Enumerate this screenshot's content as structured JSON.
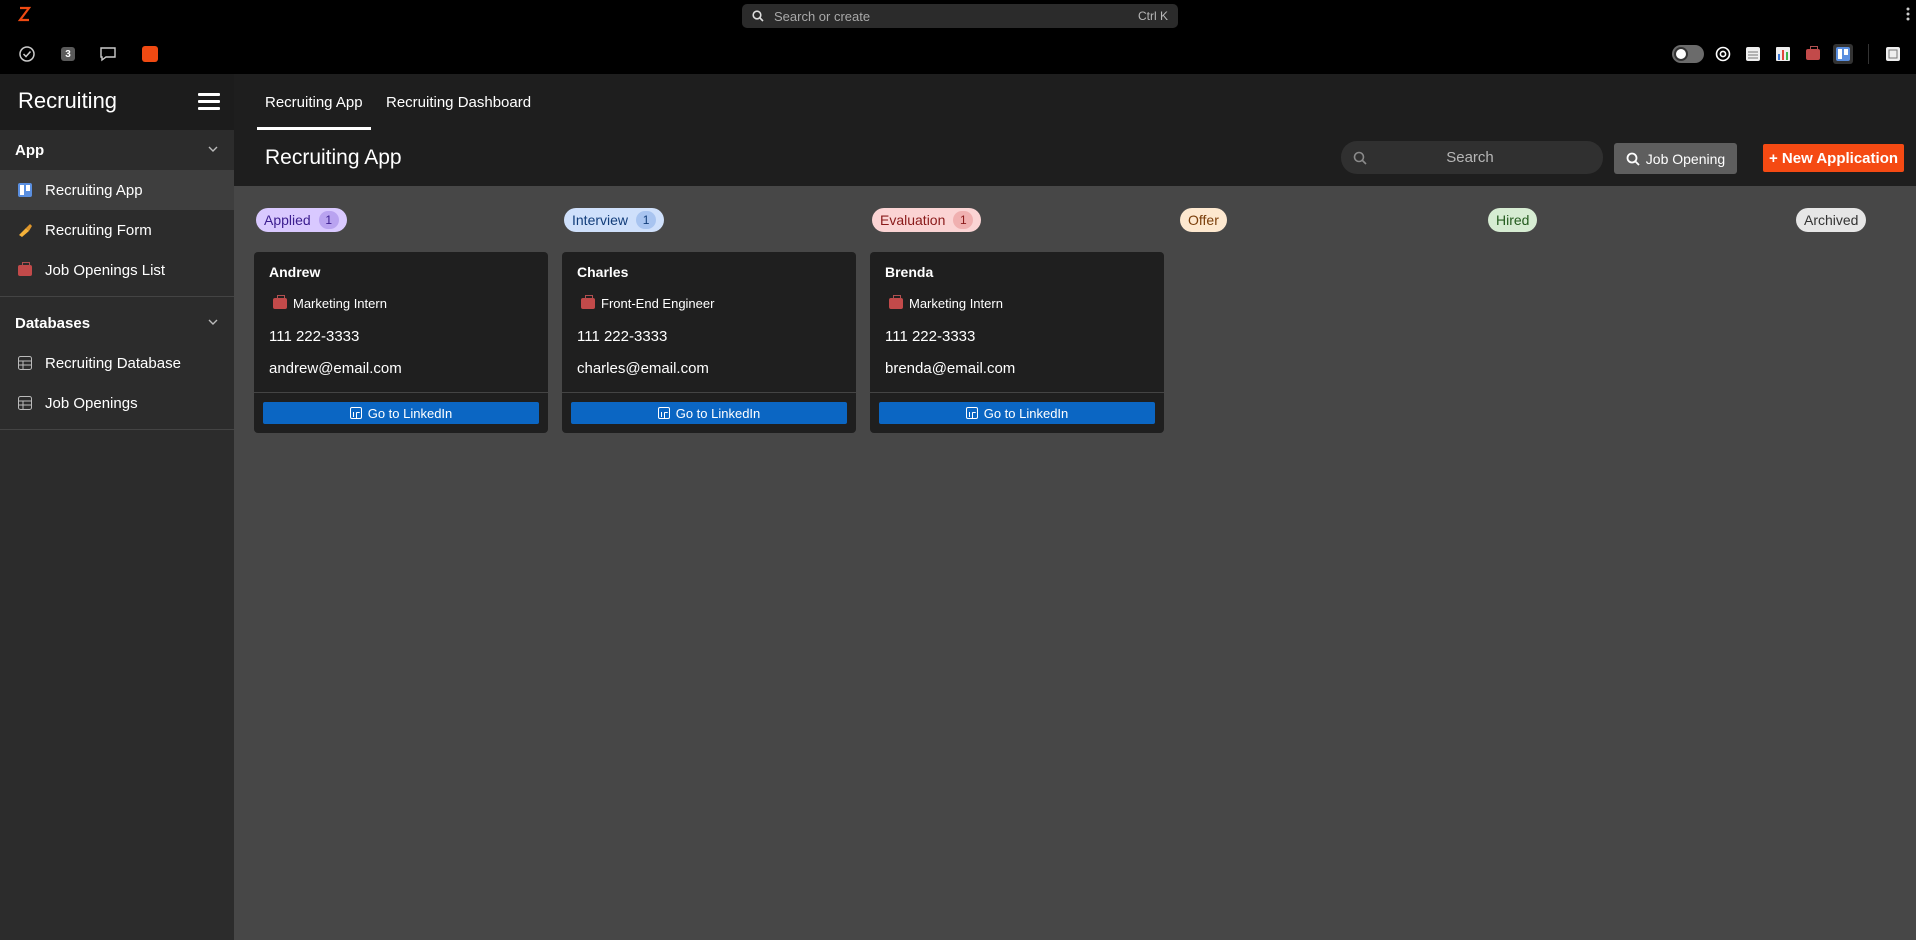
{
  "topbar": {
    "search_placeholder": "Search or create",
    "shortcut": "Ctrl K"
  },
  "toolbar": {
    "left_icons": [
      "check-circle-icon",
      "count-badge",
      "comment-icon",
      "app-orange-icon"
    ],
    "badge_count": "3",
    "right_icons": [
      "toggle-switch",
      "help-ring-icon",
      "table-icon",
      "chart-icon",
      "briefcase-icon",
      "kanban-icon",
      "panel-icon"
    ]
  },
  "sidebar": {
    "title": "Recruiting",
    "sections": [
      {
        "label": "App",
        "items": [
          {
            "label": "Recruiting App",
            "icon": "kanban-icon",
            "active": true
          },
          {
            "label": "Recruiting Form",
            "icon": "writing-hand-icon",
            "active": false
          },
          {
            "label": "Job Openings List",
            "icon": "briefcase-icon",
            "active": false
          }
        ]
      },
      {
        "label": "Databases",
        "items": [
          {
            "label": "Recruiting Database",
            "icon": "table-icon",
            "active": false
          },
          {
            "label": "Job Openings",
            "icon": "table-icon",
            "active": false
          }
        ]
      }
    ]
  },
  "main": {
    "tabs": [
      {
        "label": "Recruiting App",
        "active": true
      },
      {
        "label": "Recruiting Dashboard",
        "active": false
      }
    ],
    "title": "Recruiting App",
    "search_placeholder": "Search",
    "job_opening_button": "Job Opening",
    "new_application_button": "+ New Application"
  },
  "board": {
    "columns": [
      {
        "label": "Applied",
        "count": "1",
        "bg": "#d9c9ff",
        "fg": "#3b1d8f",
        "count_bg": "#b9a3f0"
      },
      {
        "label": "Interview",
        "count": "1",
        "bg": "#cfe0fb",
        "fg": "#123d7a",
        "count_bg": "#a8c4f0"
      },
      {
        "label": "Evaluation",
        "count": "1",
        "bg": "#fbd4d4",
        "fg": "#8a1a1a",
        "count_bg": "#f0b0b0"
      },
      {
        "label": "Offer",
        "count": "",
        "bg": "#fde8cf",
        "fg": "#7a3e0a",
        "count_bg": ""
      },
      {
        "label": "Hired",
        "count": "",
        "bg": "#d6ecd2",
        "fg": "#245b1e",
        "count_bg": ""
      },
      {
        "label": "Archived",
        "count": "",
        "bg": "#e6e6e6",
        "fg": "#333333",
        "count_bg": ""
      }
    ],
    "cards": [
      {
        "name": "Andrew",
        "role": "Marketing Intern",
        "phone": "111 222-3333",
        "email": "andrew@email.com",
        "button": "Go to LinkedIn"
      },
      {
        "name": "Charles",
        "role": "Front-End Engineer",
        "phone": "111 222-3333",
        "email": "charles@email.com",
        "button": "Go to LinkedIn"
      },
      {
        "name": "Brenda",
        "role": "Marketing Intern",
        "phone": "111 222-3333",
        "email": "brenda@email.com",
        "button": "Go to LinkedIn"
      }
    ]
  },
  "colors": {
    "accent": "#f54a13",
    "linkedin": "#0b66c3",
    "board_bg": "#474747",
    "sidebar_bg": "#2c2c2c"
  }
}
